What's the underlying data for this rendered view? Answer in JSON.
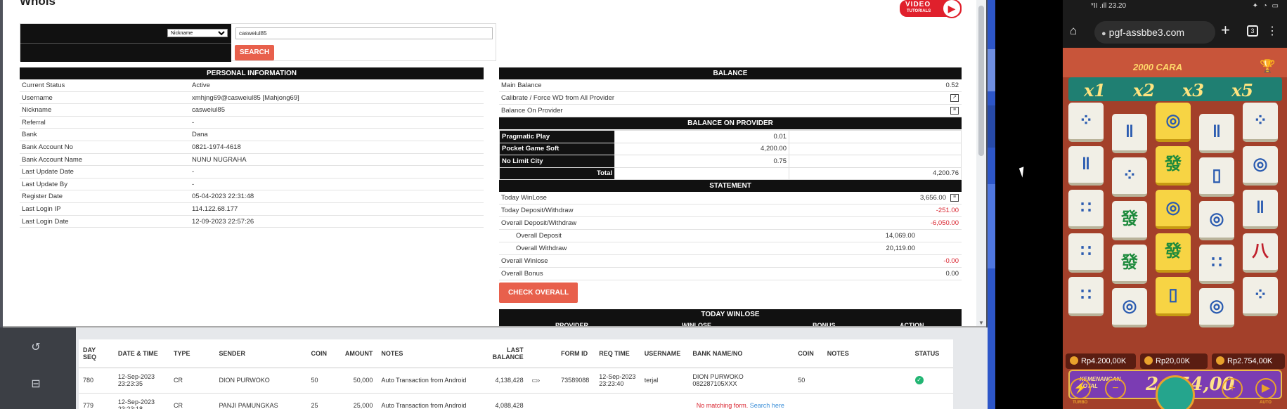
{
  "modal": {
    "title": "Whois",
    "video_logo": {
      "line1": "VIDEO",
      "line2": "TUTORIALS"
    },
    "search": {
      "select_value": "Nickname",
      "input_value": "casweiul85",
      "button": "SEARCH"
    },
    "personal": {
      "header": "PERSONAL INFORMATION",
      "rows": [
        {
          "k": "Current Status",
          "v": "Active"
        },
        {
          "k": "Username",
          "v": "xmhjng69@casweiul85  [Mahjong69]"
        },
        {
          "k": "Nickname",
          "v": "casweiul85"
        },
        {
          "k": "Referral",
          "v": "-"
        },
        {
          "k": "Bank",
          "v": "Dana"
        },
        {
          "k": "Bank Account No",
          "v": "0821-1974-4618"
        },
        {
          "k": "Bank Account Name",
          "v": "NUNU NUGRAHA"
        },
        {
          "k": "Last Update Date",
          "v": "-"
        },
        {
          "k": "Last Update By",
          "v": "-"
        },
        {
          "k": "Register Date",
          "v": "05-04-2023 22:31:48"
        },
        {
          "k": "Last Login IP",
          "v": "114.122.68.177"
        },
        {
          "k": "Last Login Date",
          "v": "12-09-2023 22:57:26"
        }
      ]
    },
    "balance": {
      "header": "BALANCE",
      "main_label": "Main Balance",
      "main_value": "0.52",
      "calibrate_label": "Calibrate / Force WD from All Provider",
      "bop_label": "Balance On Provider"
    },
    "balance_on_provider": {
      "header": "BALANCE ON PROVIDER",
      "rows": [
        {
          "name": "Pragmatic Play",
          "value": "0.01"
        },
        {
          "name": "Pocket Game Soft",
          "value": "4,200.00"
        },
        {
          "name": "No Limit City",
          "value": "0.75"
        }
      ],
      "total_label": "Total",
      "total_value": "4,200.76"
    },
    "statement": {
      "header": "STATEMENT",
      "today_winlose_label": "Today WinLose",
      "today_winlose_value": "3,656.00",
      "today_dw_label": "Today Deposit/Withdraw",
      "today_dw_value": "-251.00",
      "overall_dw_label": "Overall Deposit/Withdraw",
      "overall_dw_value": "-6,050.00",
      "overall_deposit_label": "Overall Deposit",
      "overall_deposit_value": "14,069.00",
      "overall_withdraw_label": "Overall Withdraw",
      "overall_withdraw_value": "20,119.00",
      "overall_winlose_label": "Overall Winlose",
      "overall_winlose_value": "-0.00",
      "overall_bonus_label": "Overall Bonus",
      "overall_bonus_value": "0.00",
      "check_button": "CHECK OVERALL"
    },
    "today_winlose": {
      "header": "TODAY WINLOSE",
      "columns": [
        "PROVIDER",
        "WINLOSE",
        "BONUS",
        "ACTION"
      ]
    }
  },
  "bg_table": {
    "headers": [
      "DAY SEQ",
      "DATE & TIME",
      "TYPE",
      "SENDER",
      "COIN",
      "AMOUNT",
      "NOTES",
      "LAST BALANCE",
      "",
      "FORM ID",
      "REQ TIME",
      "USERNAME",
      "BANK NAME/NO",
      "COIN",
      "NOTES",
      "STATUS"
    ],
    "row1": {
      "seq": "780",
      "date": "12-Sep-2023 23:23:35",
      "type": "CR",
      "sender": "DION PURWOKO",
      "coin": "50",
      "amount": "50,000",
      "notes": "Auto Transaction from Android",
      "last_balance": "4,138,428",
      "form_id": "73589088",
      "req_time": "12-Sep-2023 23:23:40",
      "username": "terjal",
      "bank": "DION PURWOKO 082287105XXX",
      "coin2": "50"
    },
    "row2": {
      "seq": "779",
      "date": "12-Sep-2023 23:23:18",
      "type": "CR",
      "sender": "PANJI PAMUNGKAS",
      "coin": "25",
      "amount": "25,000",
      "notes": "Auto Transaction from Android",
      "last_balance": "4,088,428",
      "no_match": "No matching form.",
      "search_here": "Search here"
    }
  },
  "phone": {
    "status_left": "*II .ıll 23.20",
    "status_right": "✦ ◔ ▭",
    "url": "pgf-assbbe3.com",
    "tab_count": "3",
    "game": {
      "header_text": "2000 CARA",
      "multipliers": [
        "x1",
        "x2",
        "x3",
        "x5"
      ],
      "win_label_line1": "KEMENANGAN",
      "win_label_line2": "TOTAL",
      "win_value": "2.754,00",
      "pills": [
        "Rp4.200,00K",
        "Rp20,00K",
        "Rp2.754,00K"
      ],
      "turbo": "TURBO",
      "auto": "AUTO"
    }
  },
  "colors": {
    "accent_button": "#e8604c",
    "header_black": "#111111",
    "negative_red": "#d9232e",
    "status_green": "#22b573"
  }
}
